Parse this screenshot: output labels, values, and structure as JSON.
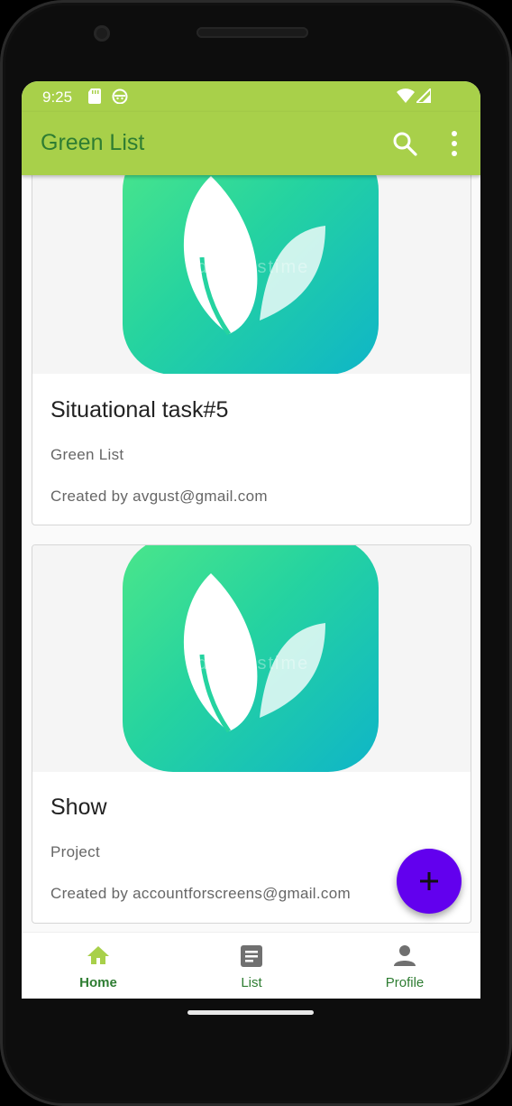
{
  "status_bar": {
    "time": "9:25",
    "left_icons": [
      "sd-card-icon",
      "android-debug-icon"
    ],
    "right_icons": [
      "wifi-icon",
      "signal-icon"
    ]
  },
  "app_bar": {
    "title": "Green List",
    "actions": [
      "search-icon",
      "more-vert-icon"
    ],
    "background": "#a8d04a",
    "title_color": "#2e7d32"
  },
  "cards": [
    {
      "title": "Situational task#5",
      "subtitle": "Green List",
      "created_by": "Created by avgust@gmail.com",
      "image": "leaf-logo"
    },
    {
      "title": "Show",
      "subtitle": "Project",
      "created_by": "Created by accountforscreens@gmail.com",
      "image": "leaf-logo"
    }
  ],
  "watermark": "dreamstime",
  "fab": {
    "icon": "plus-icon",
    "color": "#6200ee"
  },
  "bottom_nav": {
    "items": [
      {
        "label": "Home",
        "icon": "home-icon",
        "active": true
      },
      {
        "label": "List",
        "icon": "list-icon",
        "active": false
      },
      {
        "label": "Profile",
        "icon": "person-icon",
        "active": false
      }
    ],
    "active_color": "#2e7d32"
  }
}
